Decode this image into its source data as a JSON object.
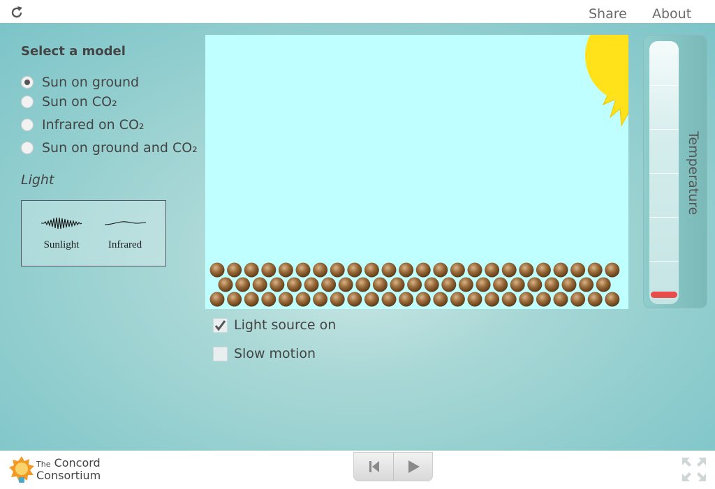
{
  "topbar": {
    "share_label": "Share",
    "about_label": "About"
  },
  "sidebar": {
    "select_title": "Select a model",
    "models": [
      {
        "label": "Sun on ground",
        "checked": true
      },
      {
        "label": "Sun on CO₂",
        "checked": false
      },
      {
        "label": "Infrared on CO₂",
        "checked": false
      },
      {
        "label": "Sun on ground and CO₂",
        "checked": false
      }
    ],
    "light_title": "Light",
    "legend": {
      "sunlight_label": "Sunlight",
      "infrared_label": "Infrared"
    }
  },
  "controls": {
    "light_source_label": "Light source on",
    "light_source_checked": true,
    "slow_motion_label": "Slow motion",
    "slow_motion_checked": false
  },
  "thermometer": {
    "label": "Temperature",
    "level_fraction": 0.02
  },
  "footer": {
    "logo_line1": "The",
    "logo_line2": "Concord",
    "logo_line3": "Consortium"
  },
  "colors": {
    "model_bg": "#bfffff",
    "ground_particle": "#9a6b3a",
    "sun": "#ffe21a",
    "thermo_fill": "#e94a4a"
  },
  "icons": [
    "reload-icon",
    "sun-icon",
    "step-back-icon",
    "play-icon",
    "fullscreen-icon",
    "checkmark-icon",
    "sunlight-wave-icon",
    "infrared-wave-icon"
  ]
}
